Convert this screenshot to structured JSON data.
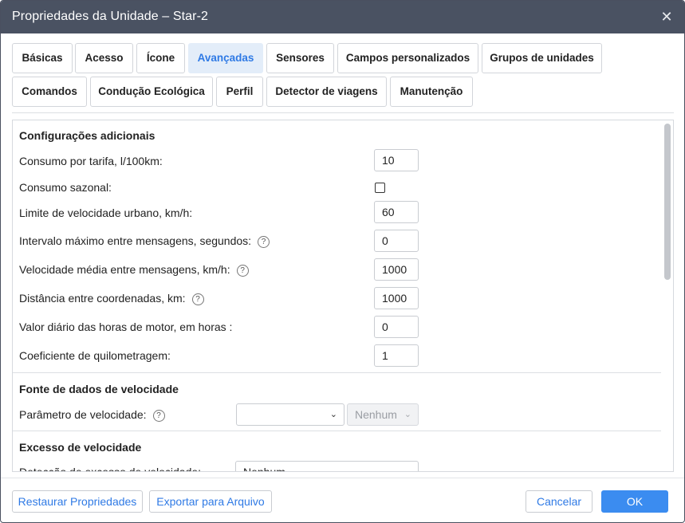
{
  "window": {
    "title": "Propriedades da Unidade – Star-2",
    "close_glyph": "✕"
  },
  "tabs": [
    {
      "label": "Básicas"
    },
    {
      "label": "Acesso"
    },
    {
      "label": "Ícone"
    },
    {
      "label": "Avançadas",
      "active": true
    },
    {
      "label": "Sensores"
    },
    {
      "label": "Campos personalizados"
    },
    {
      "label": "Grupos de unidades"
    },
    {
      "label": "Comandos"
    },
    {
      "label": "Condução Ecológica"
    },
    {
      "label": "Perfil"
    },
    {
      "label": "Detector de viagens"
    },
    {
      "label": "Manutenção"
    }
  ],
  "sections": {
    "additional": {
      "title": "Configurações adicionais",
      "fields": [
        {
          "label": "Consumo por tarifa, l/100km:",
          "value": "10"
        },
        {
          "label": "Consumo sazonal:",
          "checked": false
        },
        {
          "label": "Limite de velocidade urbano, km/h:",
          "value": "60"
        },
        {
          "label": "Intervalo máximo entre mensagens, segundos:",
          "value": "0",
          "help": "?"
        },
        {
          "label": "Velocidade média entre mensagens, km/h:",
          "value": "1000",
          "help": "?"
        },
        {
          "label": "Distância entre coordenadas, km:",
          "value": "1000",
          "help": "?"
        },
        {
          "label": "Valor diário das horas de motor, em horas :",
          "value": "0"
        },
        {
          "label": "Coeficiente de quilometragem:",
          "value": "1"
        }
      ]
    },
    "speed_source": {
      "title": "Fonte de dados de velocidade",
      "param_label": "Parâmetro de velocidade:",
      "help": "?",
      "param_value": "",
      "unit_value": "Nenhum"
    },
    "overspeed": {
      "title": "Excesso de velocidade",
      "detect_label": "Detecção de excesso de velocidade:",
      "detect_value": "Nenhum"
    }
  },
  "footer": {
    "restore": "Restaurar Propriedades",
    "export": "Exportar para Arquivo",
    "cancel": "Cancelar",
    "ok": "OK"
  },
  "colors": {
    "titlebar": "#4a5262",
    "accent": "#2f7ae5",
    "primary_button": "#3b8cf0",
    "active_tab_bg": "#e3edf9"
  }
}
